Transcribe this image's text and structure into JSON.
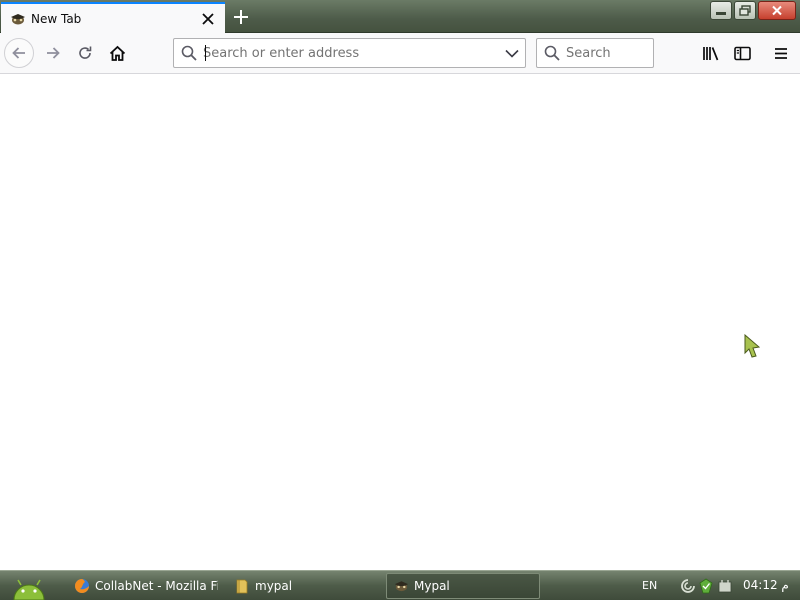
{
  "tabs": [
    {
      "title": "New Tab",
      "active": true
    }
  ],
  "window_controls": {
    "minimize": "minimize",
    "restore": "restore",
    "close": "close"
  },
  "navbar": {
    "address_placeholder": "Search or enter address",
    "address_value": "",
    "search_placeholder": "Search"
  },
  "icons": {
    "back": "back-arrow-icon",
    "forward": "forward-arrow-icon",
    "reload": "reload-icon",
    "home": "home-icon",
    "library": "library-icon",
    "sidebar": "sidebar-icon",
    "menu": "hamburger-menu-icon"
  },
  "taskbar": {
    "tasks": [
      {
        "label": "CollabNet - Mozilla Fi…",
        "icon": "firefox-icon",
        "active": false
      },
      {
        "label": "mypal",
        "icon": "folder-icon",
        "active": false
      },
      {
        "label": "Mypal",
        "icon": "mypal-icon",
        "active": true
      }
    ],
    "language": "EN",
    "clock": "04:12 م"
  },
  "colors": {
    "accent": "#0a84ff",
    "chrome_dark": "#4d5b49",
    "toolbar_bg": "#f9f9fa",
    "close_red": "#c6402e"
  }
}
